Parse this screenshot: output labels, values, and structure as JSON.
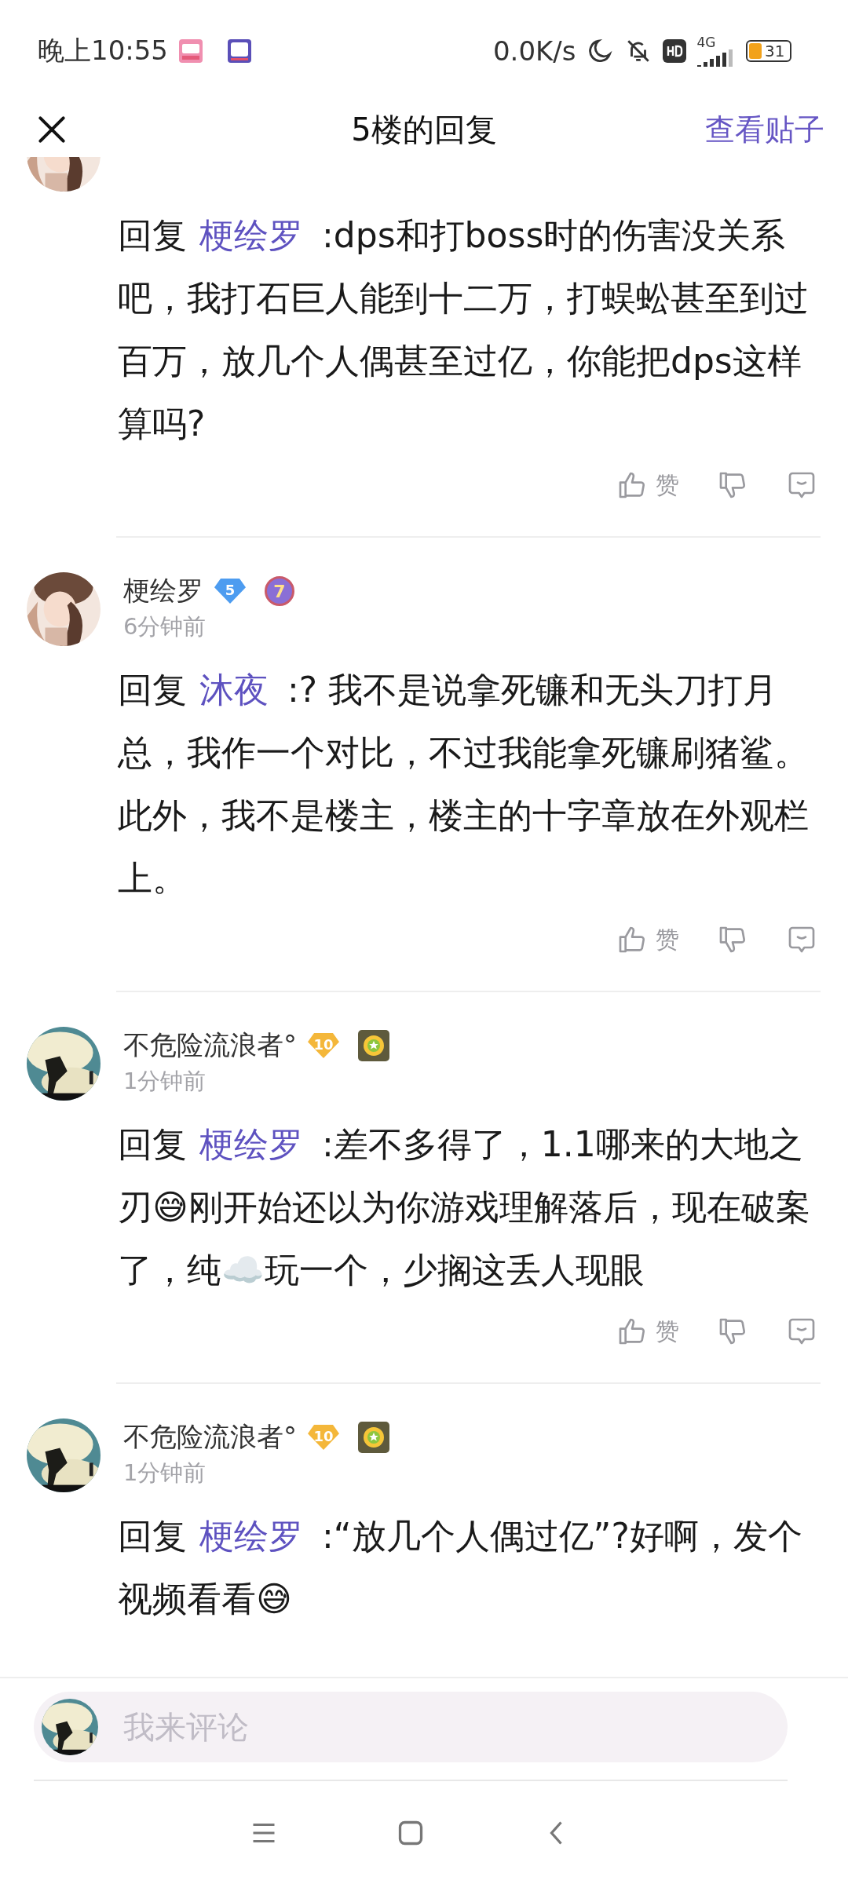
{
  "status_bar": {
    "time": "晚上10:55",
    "speed": "0.0K/s",
    "network": "4G",
    "battery": "31"
  },
  "header": {
    "title": "5楼的回复",
    "link": "查看贴子"
  },
  "comments": [
    {
      "cut_top": true,
      "prefix": "回复",
      "mention": "梗绘罗",
      "body": ":dps和打boss时的伤害没关系吧，我打石巨人能到十二万，打蜈蚣甚至到过百万，放几个人偶甚至过亿，你能把dps这样算吗?",
      "like_label": "赞"
    },
    {
      "cut_top": false,
      "user": {
        "name": "梗绘罗",
        "level": "5",
        "medal": {
          "kind": "number",
          "text": "7"
        }
      },
      "time": "6分钟前",
      "prefix": "回复",
      "mention": "沐夜",
      "body": ":? 我不是说拿死镰和无头刀打月总，我作一个对比，不过我能拿死镰刷猪鲨。此外，我不是楼主，楼主的十字章放在外观栏上。",
      "like_label": "赞"
    },
    {
      "cut_top": false,
      "user": {
        "name": "不危险流浪者°",
        "level": "10",
        "medal": {
          "kind": "star"
        }
      },
      "time": "1分钟前",
      "prefix": "回复",
      "mention": "梗绘罗",
      "body": ":差不多得了，1.1哪来的大地之刃😅刚开始还以为你游戏理解落后，现在破案了，纯☁️玩一个，少搁这丢人现眼",
      "like_label": "赞"
    },
    {
      "cut_top": false,
      "user": {
        "name": "不危险流浪者°",
        "level": "10",
        "medal": {
          "kind": "star"
        }
      },
      "time": "1分钟前",
      "prefix": "回复",
      "mention": "梗绘罗",
      "body": ":“放几个人偶过亿”?好啊，发个视频看看😅"
    }
  ],
  "composer": {
    "placeholder": "我来评论"
  }
}
